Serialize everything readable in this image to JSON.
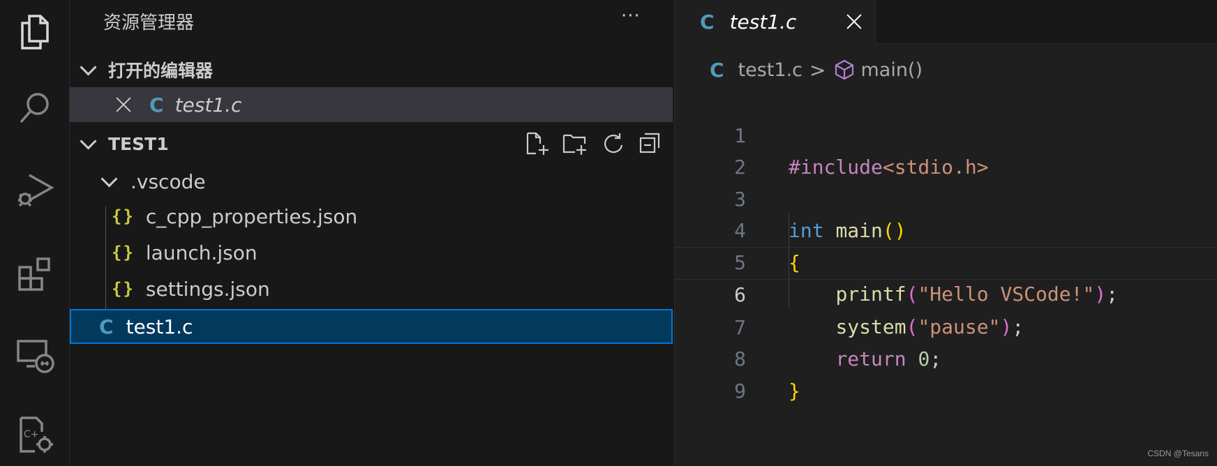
{
  "activity_bar": {
    "items": [
      {
        "icon": "files-icon",
        "label": "Explorer"
      },
      {
        "icon": "search-icon",
        "label": "Search"
      },
      {
        "icon": "run-debug-icon",
        "label": "Run and Debug"
      },
      {
        "icon": "extensions-icon",
        "label": "Extensions"
      },
      {
        "icon": "remote-explorer-icon",
        "label": "Remote Explorer"
      },
      {
        "icon": "cpp-settings-icon",
        "label": "C/C++ Settings"
      }
    ]
  },
  "sidebar": {
    "title": "资源管理器",
    "more": "···",
    "open_editors": {
      "header": "打开的编辑器",
      "items": [
        {
          "icon": "c-file-icon",
          "icon_text": "C",
          "name": "test1.c"
        }
      ]
    },
    "folder": {
      "header": "TEST1",
      "vscode_folder": ".vscode",
      "json_icon_text": "{}",
      "c_icon_text": "C",
      "files": [
        {
          "name": "c_cpp_properties.json"
        },
        {
          "name": "launch.json"
        },
        {
          "name": "settings.json"
        }
      ],
      "root_file": "test1.c"
    }
  },
  "editor": {
    "tab": {
      "icon_text": "C",
      "name": "test1.c"
    },
    "breadcrumb": {
      "file_icon_text": "C",
      "file": "test1.c",
      "separator": ">",
      "symbol": "main()"
    },
    "current_line": 6,
    "line_numbers": [
      "1",
      "2",
      "3",
      "4",
      "5",
      "6",
      "7",
      "8",
      "9"
    ],
    "code": {
      "l1": {
        "hash": "#include",
        "header": "<stdio.h>"
      },
      "l3": {
        "type": "int",
        "fn": "main",
        "open": "(",
        "close": ")"
      },
      "l4": {
        "brace": "{"
      },
      "l5": {
        "fn": "printf",
        "open": "(",
        "str": "\"Hello VSCode!\"",
        "close": ")",
        "semi": ";"
      },
      "l6": {
        "fn": "system",
        "open": "(",
        "str": "\"pause\"",
        "close": ")",
        "semi": ";"
      },
      "l7": {
        "kw": "return",
        "num": "0",
        "semi": ";"
      },
      "l8": {
        "brace": "}"
      }
    }
  },
  "watermark": "CSDN @Tesans",
  "colors": {
    "accent": "#0078d4",
    "selection": "#04395e",
    "c_icon": "#519aba",
    "json_icon": "#cbcb41"
  }
}
